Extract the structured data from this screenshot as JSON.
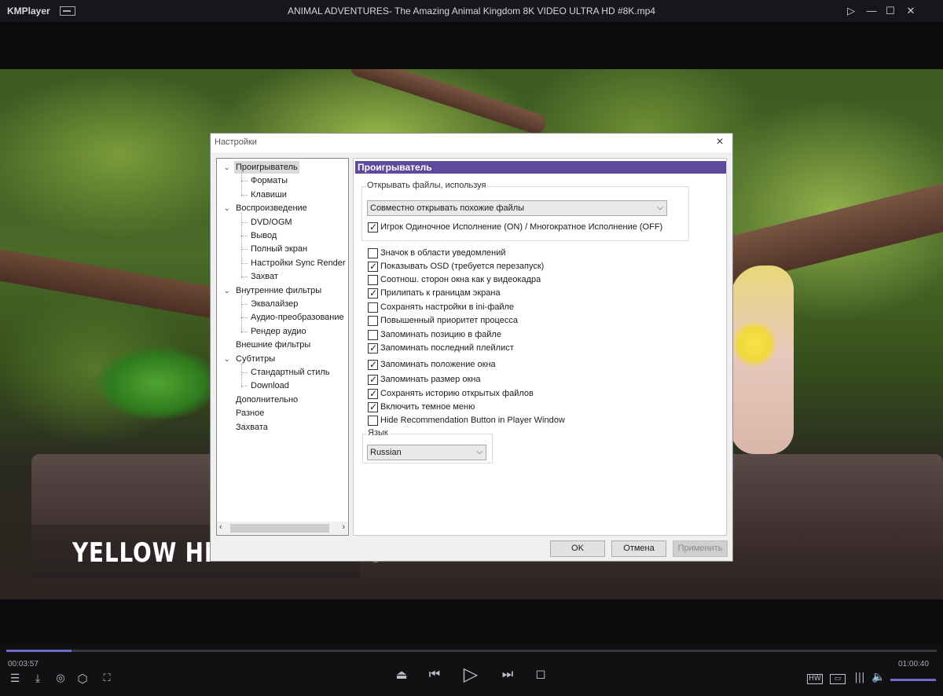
{
  "app": {
    "logo": "KMPlayer",
    "window_title": "ANIMAL ADVENTURES- The Amazing Animal Kingdom 8K VIDEO ULTRA HD #8K.mp4"
  },
  "video": {
    "caption": "YELLOW HEADED PARROT"
  },
  "dialog": {
    "title": "Настройки",
    "tree": [
      {
        "label": "Проигрыватель",
        "level": 0,
        "selected": true,
        "expanded": true
      },
      {
        "label": "Форматы",
        "level": 1
      },
      {
        "label": "Клавиши",
        "level": 1
      },
      {
        "label": "Воспроизведение",
        "level": 0,
        "expanded": true
      },
      {
        "label": "DVD/OGM",
        "level": 1
      },
      {
        "label": "Вывод",
        "level": 1
      },
      {
        "label": "Полный экран",
        "level": 1
      },
      {
        "label": "Настройки Sync Render",
        "level": 1
      },
      {
        "label": "Захват",
        "level": 1
      },
      {
        "label": "Внутренние фильтры",
        "level": 0,
        "expanded": true
      },
      {
        "label": "Эквалайзер",
        "level": 1
      },
      {
        "label": "Аудио-преобразование",
        "level": 1
      },
      {
        "label": "Рендер аудио",
        "level": 1
      },
      {
        "label": "Внешние фильтры",
        "level": 0
      },
      {
        "label": "Субтитры",
        "level": 0,
        "expanded": true
      },
      {
        "label": "Стандартный стиль",
        "level": 1
      },
      {
        "label": "Download",
        "level": 1
      },
      {
        "label": "Дополнительно",
        "level": 0
      },
      {
        "label": "Разное",
        "level": 0
      },
      {
        "label": "Захвата",
        "level": 0
      }
    ],
    "panel_title": "Проигрыватель",
    "open_group_title": "Открывать файлы, используя",
    "open_mode_value": "Совместно открывать похожие файлы",
    "single_instance": {
      "label": "Игрок Одиночное Исполнение (ON) / Многократное Исполнение (OFF)",
      "checked": true
    },
    "options": [
      {
        "label": "Значок в области уведомлений",
        "checked": false
      },
      {
        "label": "Показывать OSD (требуется перезапуск)",
        "checked": true
      },
      {
        "label": "Соотнош. сторон окна как у видеокадра",
        "checked": false
      },
      {
        "label": "Прилипать к границам экрана",
        "checked": true
      },
      {
        "label": "Сохранять настройки в ini-файле",
        "checked": false
      },
      {
        "label": "Повышенный приоритет процесса",
        "checked": false
      },
      {
        "label": "Запоминать позицию в файле",
        "checked": false
      },
      {
        "label": "Запоминать последний плейлист",
        "checked": true
      },
      {
        "label": "Запоминать положение окна",
        "checked": true
      },
      {
        "label": "Запоминать размер окна",
        "checked": true
      },
      {
        "label": "Сохранять историю открытых файлов",
        "checked": true
      },
      {
        "label": "Включить темное меню",
        "checked": true
      },
      {
        "label": "Hide Recommendation Button in Player Window",
        "checked": false
      }
    ],
    "lang_group_title": "Язык",
    "language_value": "Russian",
    "buttons": {
      "ok": "OK",
      "cancel": "Отмена",
      "apply": "Применить"
    }
  },
  "player": {
    "elapsed": "00:03:57",
    "total": "01:00:40",
    "progress_fraction": 0.07,
    "volume_fraction": 1.0,
    "colors": {
      "accent": "#6e6ad0",
      "panel_header": "#5d4a9c"
    }
  }
}
